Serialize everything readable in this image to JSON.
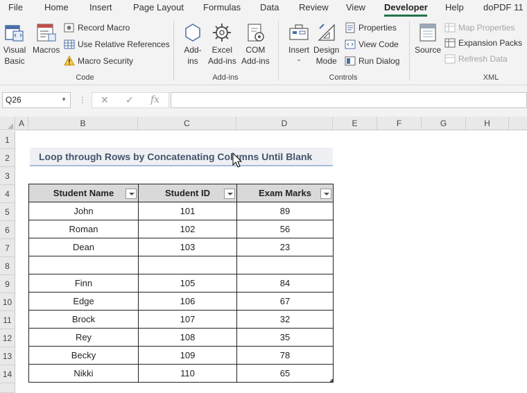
{
  "menu": {
    "items": [
      "File",
      "Home",
      "Insert",
      "Page Layout",
      "Formulas",
      "Data",
      "Review",
      "View",
      "Developer",
      "Help",
      "doPDF 11"
    ],
    "active": "Developer"
  },
  "ribbon": {
    "code": {
      "label": "Code",
      "visual_basic": "Visual\nBasic",
      "macros": "Macros",
      "record_macro": "Record Macro",
      "relative_refs": "Use Relative References",
      "macro_security": "Macro Security"
    },
    "addins": {
      "label": "Add-ins",
      "addins_btn": "Add-\nins",
      "excel_addins": "Excel\nAdd-ins",
      "com_addins": "COM\nAdd-ins"
    },
    "controls": {
      "label": "Controls",
      "insert": "Insert",
      "design_mode": "Design\nMode",
      "properties": "Properties",
      "view_code": "View Code",
      "run_dialog": "Run Dialog"
    },
    "xml": {
      "label": "XML",
      "source": "Source",
      "map_properties": "Map Properties",
      "expansion_packs": "Expansion Packs",
      "refresh_data": "Refresh Data"
    }
  },
  "formula_bar": {
    "name_box": "Q26",
    "formula": ""
  },
  "columns": [
    "A",
    "B",
    "C",
    "D",
    "E",
    "F",
    "G",
    "H"
  ],
  "rows": [
    "1",
    "2",
    "3",
    "4",
    "5",
    "6",
    "7",
    "8",
    "9",
    "10",
    "11",
    "12",
    "13",
    "14"
  ],
  "sheet": {
    "title": "Loop through Rows by Concatenating Columns Until Blank",
    "headers": [
      "Student Name",
      "Student ID",
      "Exam Marks"
    ],
    "data": [
      [
        "John",
        "101",
        "89"
      ],
      [
        "Roman",
        "102",
        "56"
      ],
      [
        "Dean",
        "103",
        "23"
      ],
      [
        "",
        "",
        ""
      ],
      [
        "Finn",
        "105",
        "84"
      ],
      [
        "Edge",
        "106",
        "67"
      ],
      [
        "Brock",
        "107",
        "32"
      ],
      [
        "Rey",
        "108",
        "35"
      ],
      [
        "Becky",
        "109",
        "78"
      ],
      [
        "Nikki",
        "110",
        "65"
      ]
    ]
  },
  "colors": {
    "accent": "#217346",
    "title_text": "#44546a",
    "header_fill": "#d9d9d9"
  }
}
